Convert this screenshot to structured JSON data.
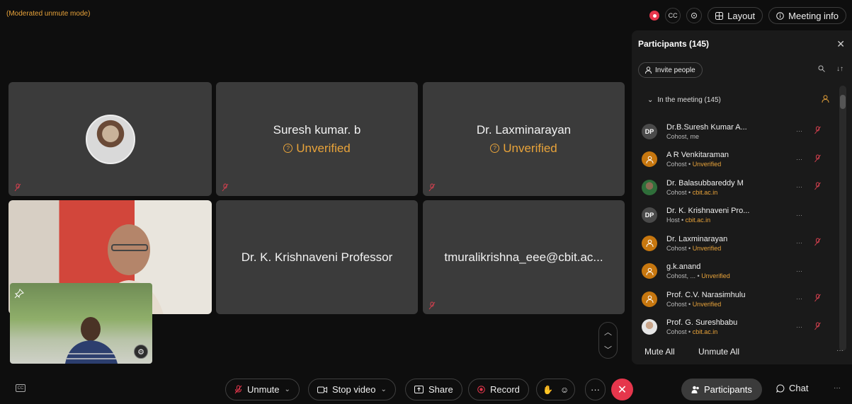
{
  "header": {
    "mode_label": "(Moderated unmute mode)",
    "cc_label": "CC",
    "layout_label": "Layout",
    "meeting_info_label": "Meeting info"
  },
  "tiles": [
    {
      "name": "",
      "status": ""
    },
    {
      "name": "Suresh kumar. b",
      "status": "Unverified"
    },
    {
      "name": "Dr. Laxminarayan",
      "status": "Unverified"
    },
    {
      "name": "Dr. K. Krishnaveni Professor",
      "status": ""
    },
    {
      "name": "tmuralikrishna_eee@cbit.ac...",
      "status": ""
    }
  ],
  "panel": {
    "title": "Participants (145)",
    "invite_label": "Invite people",
    "section_label": "In the meeting (145)",
    "participants": [
      {
        "avatar": "initials",
        "initials": "DP",
        "name": "Dr.B.Suresh Kumar A...",
        "role": "Cohost, me",
        "org": "",
        "muted": true
      },
      {
        "avatar": "generic",
        "initials": "",
        "name": "A R Venkitaraman",
        "role": "Cohost",
        "org": "Unverified",
        "muted": true
      },
      {
        "avatar": "photo-a",
        "initials": "",
        "name": "Dr. Balasubbareddy M",
        "role": "Cohost",
        "org": "cbit.ac.in",
        "muted": true
      },
      {
        "avatar": "initials",
        "initials": "DP",
        "name": "Dr. K. Krishnaveni Pro...",
        "role": "Host",
        "org": "cbit.ac.in",
        "muted": false
      },
      {
        "avatar": "generic",
        "initials": "",
        "name": "Dr. Laxminarayan",
        "role": "Cohost",
        "org": "Unverified",
        "muted": true
      },
      {
        "avatar": "generic",
        "initials": "",
        "name": "g.k.anand",
        "role": "Cohost, ...",
        "org": "Unverified",
        "muted": false
      },
      {
        "avatar": "generic",
        "initials": "",
        "name": "Prof. C.V. Narasimhulu",
        "role": "Cohost",
        "org": "Unverified",
        "muted": true
      },
      {
        "avatar": "photo-b",
        "initials": "",
        "name": "Prof. G. Sureshbabu",
        "role": "Cohost",
        "org": "cbit.ac.in",
        "muted": true
      }
    ],
    "mute_all_label": "Mute All",
    "unmute_all_label": "Unmute All"
  },
  "toolbar": {
    "cc_label": "CC",
    "unmute_label": "Unmute",
    "stop_video_label": "Stop video",
    "share_label": "Share",
    "record_label": "Record",
    "participants_label": "Participants",
    "chat_label": "Chat"
  },
  "colors": {
    "accent_orange": "#e8a33a",
    "danger_red": "#e5364c",
    "tile_gray": "#3b3b3b",
    "panel_bg": "#1a1a1a"
  }
}
